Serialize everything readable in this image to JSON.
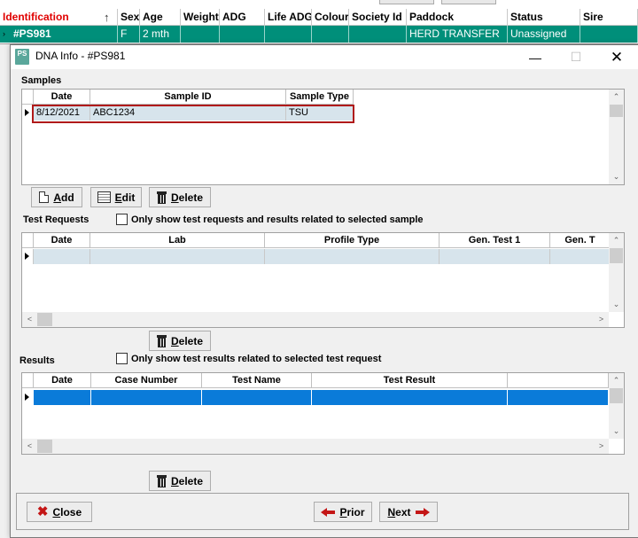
{
  "background_grid": {
    "columns": [
      "Identification",
      "Sex",
      "Age",
      "Weight",
      "ADG",
      "Life ADG",
      "Colour",
      "Society Id",
      "Paddock",
      "Status",
      "Sire"
    ],
    "row": [
      "#PS981",
      "F",
      "2 mth",
      "",
      "",
      "",
      "",
      "",
      "HERD TRANSFER",
      "Unassigned",
      ""
    ],
    "sort_indicator": "↑",
    "row_indicator": "›"
  },
  "window": {
    "title": "DNA Info - #PS981",
    "app_icon": "PS",
    "controls": {
      "minimize": "—",
      "maximize": "☐",
      "close": "✕"
    }
  },
  "samples": {
    "label": "Samples",
    "columns": [
      "Date",
      "Sample ID",
      "Sample Type"
    ],
    "rows": [
      [
        "8/12/2021",
        "ABC1234",
        "TSU"
      ]
    ],
    "add_label": "Add",
    "edit_label": "Edit",
    "delete_label": "Delete"
  },
  "test_requests": {
    "label": "Test Requests",
    "filter_label": "Only show test requests and results related to selected sample",
    "columns": [
      "Date",
      "Lab",
      "Profile Type",
      "Gen. Test 1",
      "Gen. T"
    ],
    "delete_label": "Delete"
  },
  "results": {
    "label": "Results",
    "filter_label": "Only show test results related to selected test request",
    "columns": [
      "Date",
      "Case Number",
      "Test Name",
      "Test Result"
    ],
    "delete_label": "Delete"
  },
  "footer": {
    "close_label": "Close",
    "prior_label": "Prior",
    "next_label": "Next"
  },
  "colors": {
    "selected_row_bg": "#008f7a",
    "highlight_blue": "#0a7bd9",
    "red_accent": "#c41616",
    "sample_row_bg": "#d7e4ec"
  }
}
